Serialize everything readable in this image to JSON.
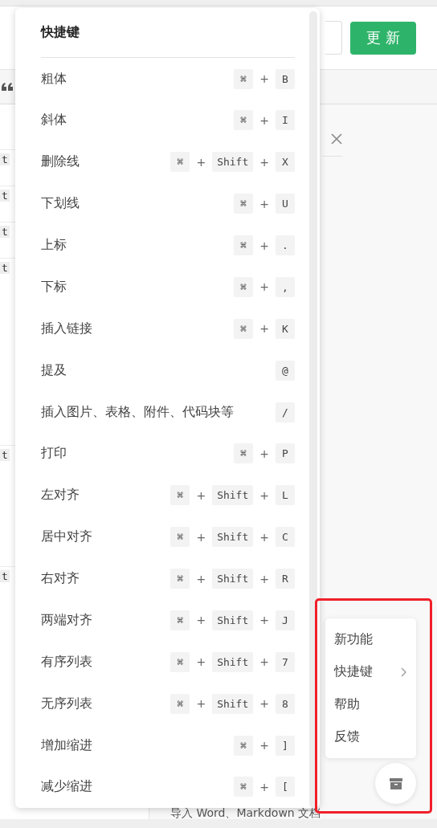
{
  "header": {
    "update_button": "更 新"
  },
  "background_keys": [
    "t",
    "t",
    "t",
    "t",
    "t",
    "t"
  ],
  "bottom_text": "导入 Word、Markdown 文档",
  "shortcuts_panel": {
    "title": "快捷键",
    "items": [
      {
        "label": "粗体",
        "keys": [
          "⌘",
          "+",
          "B"
        ]
      },
      {
        "label": "斜体",
        "keys": [
          "⌘",
          "+",
          "I"
        ]
      },
      {
        "label": "删除线",
        "keys": [
          "⌘",
          "+",
          "Shift",
          "+",
          "X"
        ]
      },
      {
        "label": "下划线",
        "keys": [
          "⌘",
          "+",
          "U"
        ]
      },
      {
        "label": "上标",
        "keys": [
          "⌘",
          "+",
          "."
        ]
      },
      {
        "label": "下标",
        "keys": [
          "⌘",
          "+",
          ","
        ]
      },
      {
        "label": "插入链接",
        "keys": [
          "⌘",
          "+",
          "K"
        ]
      },
      {
        "label": "提及",
        "keys": [
          "@"
        ]
      },
      {
        "label": "插入图片、表格、附件、代码块等",
        "keys": [
          "/"
        ]
      },
      {
        "label": "打印",
        "keys": [
          "⌘",
          "+",
          "P"
        ]
      },
      {
        "label": "左对齐",
        "keys": [
          "⌘",
          "+",
          "Shift",
          "+",
          "L"
        ]
      },
      {
        "label": "居中对齐",
        "keys": [
          "⌘",
          "+",
          "Shift",
          "+",
          "C"
        ]
      },
      {
        "label": "右对齐",
        "keys": [
          "⌘",
          "+",
          "Shift",
          "+",
          "R"
        ]
      },
      {
        "label": "两端对齐",
        "keys": [
          "⌘",
          "+",
          "Shift",
          "+",
          "J"
        ]
      },
      {
        "label": "有序列表",
        "keys": [
          "⌘",
          "+",
          "Shift",
          "+",
          "7"
        ]
      },
      {
        "label": "无序列表",
        "keys": [
          "⌘",
          "+",
          "Shift",
          "+",
          "8"
        ]
      },
      {
        "label": "增加缩进",
        "keys": [
          "⌘",
          "+",
          "]"
        ]
      },
      {
        "label": "减少缩进",
        "keys": [
          "⌘",
          "+",
          "["
        ]
      }
    ]
  },
  "help_menu": {
    "items": [
      {
        "label": "新功能",
        "has_submenu": false
      },
      {
        "label": "快捷键",
        "has_submenu": true
      },
      {
        "label": "帮助",
        "has_submenu": false
      },
      {
        "label": "反馈",
        "has_submenu": false
      }
    ]
  }
}
